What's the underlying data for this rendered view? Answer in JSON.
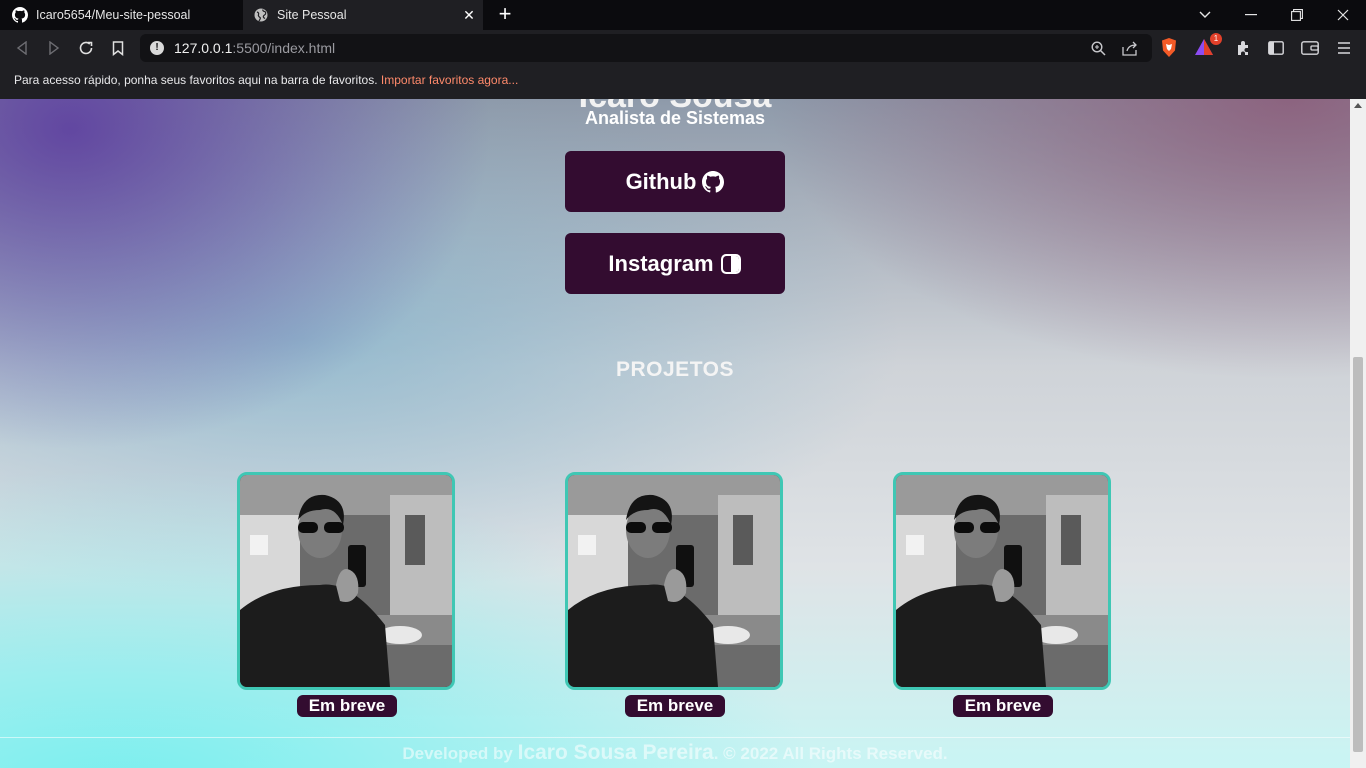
{
  "browser": {
    "tabs": [
      {
        "title": "Icaro5654/Meu-site-pessoal",
        "icon": "github-icon",
        "active": false
      },
      {
        "title": "Site Pessoal",
        "icon": "globe-icon",
        "active": true
      }
    ],
    "address": {
      "host": "127.0.0.1",
      "rest": ":5500/index.html"
    },
    "bookmarks_bar": {
      "message": "Para acesso rápido, ponha seus favoritos aqui na barra de favoritos. ",
      "import_link": "Importar favoritos agora..."
    },
    "rewards_badge": "1"
  },
  "page": {
    "name": "Icaro Sousa",
    "role": "Analista de Sistemas",
    "links": [
      {
        "label": "Github",
        "icon": "github-icon"
      },
      {
        "label": "Instagram",
        "icon": "instagram-icon"
      }
    ],
    "section_title": "PROJETOS",
    "projects": [
      {
        "label": "Em breve"
      },
      {
        "label": "Em breve"
      },
      {
        "label": "Em breve"
      }
    ],
    "footer": {
      "prefix": "Developed by ",
      "author": "Icaro Sousa Pereira",
      "suffix": ". © 2022 All Rights Reserved."
    }
  },
  "colors": {
    "button_bg": "#330c30",
    "card_border": "#3fc7b4",
    "link_accent": "#ff8a6b"
  }
}
